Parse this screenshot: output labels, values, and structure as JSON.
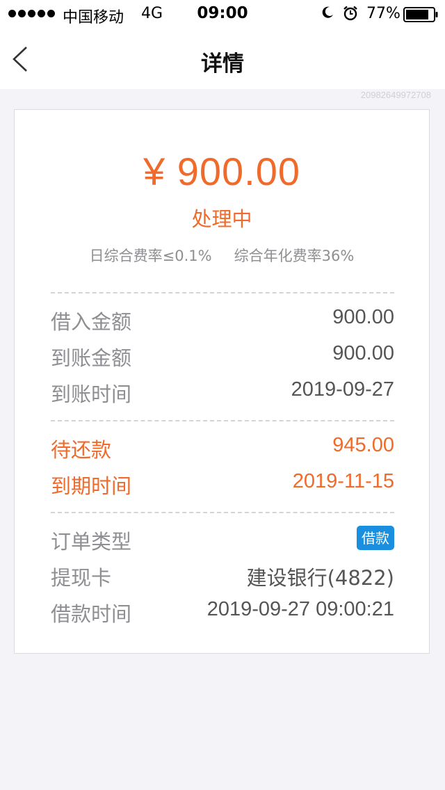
{
  "status_bar": {
    "carrier": "中国移动",
    "network": "4G",
    "time": "09:00",
    "battery": "77%",
    "icons": [
      "signal-dots",
      "moon-icon",
      "alarm-icon",
      "battery-icon"
    ]
  },
  "nav": {
    "title": "详情",
    "back_icon": "chevron-left-icon"
  },
  "order_id": "20982649972708",
  "summary": {
    "amount": "¥ 900.00",
    "status": "处理中",
    "daily_rate": "日综合费率≤0.1%",
    "annual_rate": "综合年化费率36%"
  },
  "group1": [
    {
      "label": "借入金额",
      "value": "900.00"
    },
    {
      "label": "到账金额",
      "value": "900.00"
    },
    {
      "label": "到账时间",
      "value": "2019-09-27"
    }
  ],
  "group2": [
    {
      "label": "待还款",
      "value": "945.00"
    },
    {
      "label": "到期时间",
      "value": "2019-11-15"
    }
  ],
  "group3": {
    "order_type_label": "订单类型",
    "order_type_tag": "借款",
    "card_label": "提现卡",
    "card_value": "建设银行(4822)",
    "loan_time_label": "借款时间",
    "loan_time_value": "2019-09-27 09:00:21"
  },
  "colors": {
    "accent": "#f06a2b",
    "tag": "#1a8fe0",
    "label": "#8e8e93",
    "background": "#f4f4f8"
  }
}
